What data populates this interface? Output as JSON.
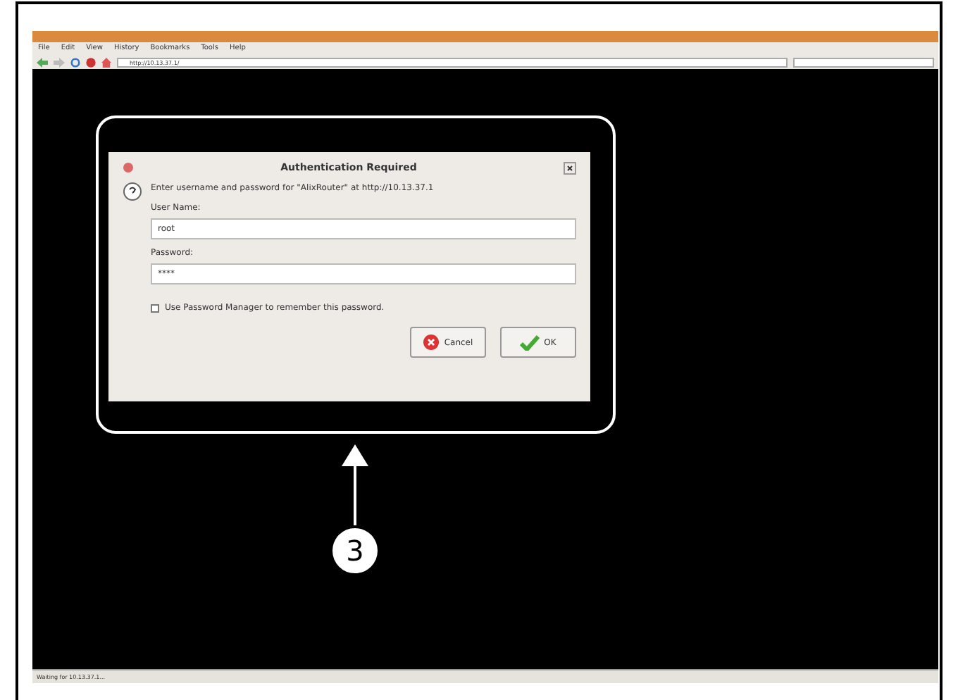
{
  "browser": {
    "menu": [
      "File",
      "Edit",
      "View",
      "History",
      "Bookmarks",
      "Tools",
      "Help"
    ],
    "address": "http://10.13.37.1/",
    "status": "Waiting for 10.13.37.1..."
  },
  "dialog": {
    "title": "Authentication Required",
    "message": "Enter username and password for \"AlixRouter\" at http://10.13.37.1",
    "fields": [
      {
        "label": "User Name:",
        "value": "root"
      },
      {
        "label": "Password:",
        "value": "****"
      }
    ],
    "checkbox": {
      "label": "Use Password Manager to remember this password.",
      "checked": false
    },
    "buttons": [
      {
        "label": "Cancel",
        "kind": "cancel"
      },
      {
        "label": "OK",
        "kind": "ok"
      }
    ]
  },
  "callout": {
    "number": "3"
  }
}
